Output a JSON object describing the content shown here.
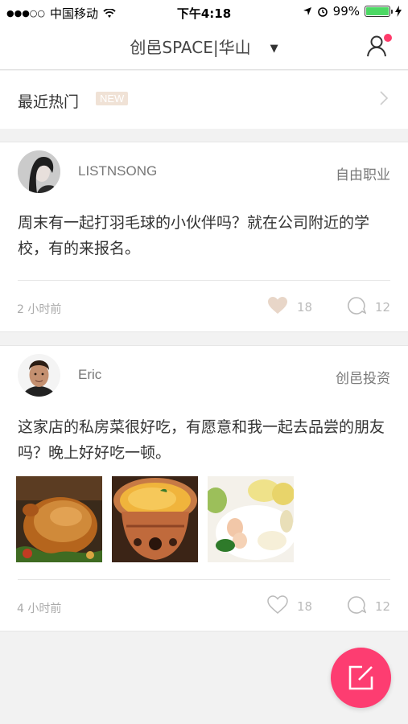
{
  "status_bar": {
    "carrier": "中国移动",
    "time": "下午4:18",
    "battery": "99%",
    "battery_level": 0.99
  },
  "nav": {
    "title": "创邑SPACE|华山",
    "icons": [
      "chevron-down-icon",
      "user-icon"
    ],
    "notification_dot_color": "#ff3b6b"
  },
  "hot": {
    "label": "最近热门",
    "badge": "NEW"
  },
  "posts": [
    {
      "author": "LISTNSONG",
      "tag": "自由职业",
      "content": "周末有一起打羽毛球的小伙伴吗？就在公司附近的学校，有的来报名。",
      "time": "2 小时前",
      "likes": "18",
      "comments": "12",
      "liked": true
    },
    {
      "author": "Eric",
      "tag": "创邑投资",
      "content": "这家店的私房菜很好吃，有愿意和我一起去品尝的朋友吗？晚上好好吃一顿。",
      "time": "4 小时前",
      "likes": "18",
      "comments": "12",
      "liked": false,
      "photos": [
        "roast-turkey-photo",
        "soup-pot-photo",
        "dumplings-photo"
      ]
    }
  ],
  "colors": {
    "accent": "#fd3d71",
    "liked_heart": "#e8d6c8",
    "badge_bg": "#f0e2d6"
  }
}
